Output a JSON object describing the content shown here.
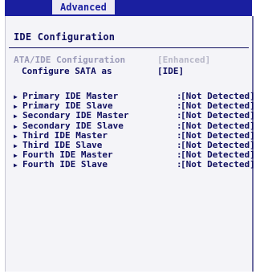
{
  "tabs": {
    "active": "Advanced"
  },
  "section": {
    "title": "IDE Configuration"
  },
  "ata": {
    "label": "ATA/IDE Configuration",
    "value": "[Enhanced]"
  },
  "sata": {
    "label": "Configure SATA as",
    "value": "[IDE]"
  },
  "icons": {
    "submenu": "right-triangle-icon"
  },
  "devices": [
    {
      "label": "Primary IDE Master",
      "value": "[Not Detected]"
    },
    {
      "label": "Primary IDE Slave",
      "value": "[Not Detected]"
    },
    {
      "label": "Secondary IDE Master",
      "value": "[Not Detected]"
    },
    {
      "label": "Secondary IDE Slave",
      "value": "[Not Detected]"
    },
    {
      "label": "Third IDE Master",
      "value": "[Not Detected]"
    },
    {
      "label": "Third IDE Slave",
      "value": "[Not Detected]"
    },
    {
      "label": "Fourth IDE Master",
      "value": "[Not Detected]"
    },
    {
      "label": "Fourth IDE Slave",
      "value": "[Not Detected]"
    }
  ],
  "colors": {
    "menu_bar": "#1a1fa0",
    "text": "#101060",
    "panel": "#f4f4f8"
  }
}
